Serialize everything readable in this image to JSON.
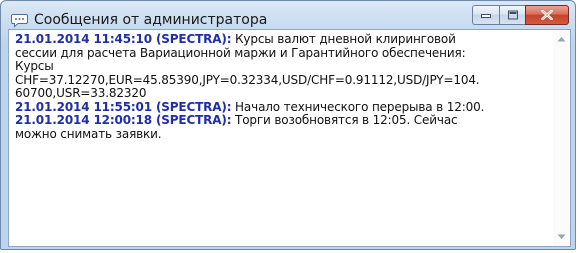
{
  "window": {
    "title": "Сообщения от администратора",
    "title_icon": "chat-bubble-icon",
    "buttons": {
      "minimize": "minimize-icon",
      "maximize": "maximize-icon",
      "close": "close-icon"
    }
  },
  "messages": [
    {
      "header": "21.01.2014 11:45:10 (SPECTRA):",
      "lines": [
        " Курсы валют дневной клиринговой",
        "сессии для расчета Вариационной маржи и Гарантийного обеспечения:",
        "Курсы",
        "CHF=37.12270,EUR=45.85390,JPY=0.32334,USD/CHF=0.91112,USD/JPY=104.",
        "60700,USR=33.82320"
      ]
    },
    {
      "header": "21.01.2014 11:55:01 (SPECTRA):",
      "lines": [
        " Начало технического перерыва в 12:00."
      ]
    },
    {
      "header": "21.01.2014 12:00:18 (SPECTRA):",
      "lines": [
        " Торги возобновятся в 12:05. Сейчас",
        "можно снимать заявки."
      ]
    }
  ],
  "colors": {
    "header_text": "#1f2fa8",
    "body_text": "#111111",
    "close_button": "#c4432b"
  }
}
